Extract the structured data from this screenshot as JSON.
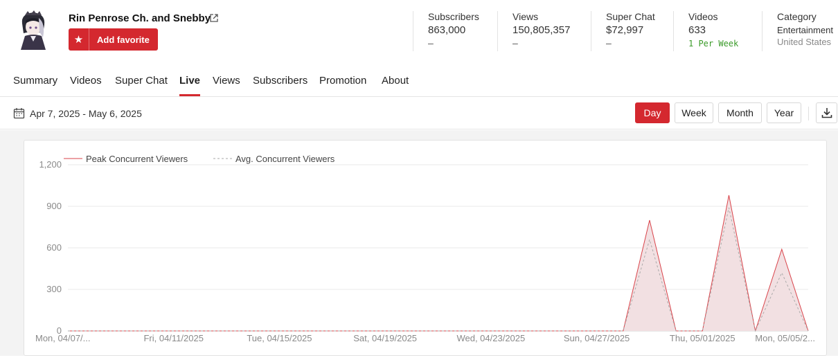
{
  "channel": {
    "name": "Rin Penrose Ch. and Snebby",
    "favorite_label": "Add favorite"
  },
  "stats": {
    "subscribers": {
      "title": "Subscribers",
      "value": "863,000",
      "delta": "–"
    },
    "views": {
      "title": "Views",
      "value": "150,805,357",
      "delta": "–"
    },
    "superchat": {
      "title": "Super Chat",
      "value": "$72,997",
      "delta": "–"
    },
    "videos": {
      "title": "Videos",
      "value": "633",
      "rate": "1 Per Week"
    },
    "category": {
      "title": "Category",
      "value": "Entertainment",
      "country": "United States"
    }
  },
  "tabs": [
    "Summary",
    "Videos",
    "Super Chat",
    "Live",
    "Views",
    "Subscribers",
    "Promotion",
    "About"
  ],
  "active_tab": "Live",
  "toolbar": {
    "date_range": "Apr 7, 2025 - May 6, 2025",
    "periods": [
      "Day",
      "Week",
      "Month",
      "Year"
    ],
    "active_period": "Day"
  },
  "colors": {
    "accent": "#d4282f",
    "peak_line": "#d9434a",
    "peak_fill": "#f2e0e2",
    "avg_line": "#aaaaaa",
    "positive": "#3a9a28"
  },
  "chart_data": {
    "type": "area",
    "x": [
      "04/07",
      "04/08",
      "04/09",
      "04/10",
      "04/11",
      "04/12",
      "04/13",
      "04/14",
      "04/15",
      "04/16",
      "04/17",
      "04/18",
      "04/19",
      "04/20",
      "04/21",
      "04/22",
      "04/23",
      "04/24",
      "04/25",
      "04/26",
      "04/27",
      "04/28",
      "04/29",
      "04/30",
      "05/01",
      "05/02",
      "05/03",
      "05/04",
      "05/05",
      "05/06"
    ],
    "series": [
      {
        "name": "Peak Concurrent Viewers",
        "style": "solid",
        "values": [
          0,
          0,
          0,
          0,
          0,
          0,
          0,
          0,
          0,
          0,
          0,
          0,
          0,
          0,
          0,
          0,
          0,
          0,
          0,
          0,
          0,
          0,
          800,
          0,
          0,
          980,
          0,
          590,
          0
        ]
      },
      {
        "name": "Avg. Concurrent Viewers",
        "style": "dashed",
        "values": [
          0,
          0,
          0,
          0,
          0,
          0,
          0,
          0,
          0,
          0,
          0,
          0,
          0,
          0,
          0,
          0,
          0,
          0,
          0,
          0,
          0,
          0,
          660,
          0,
          0,
          890,
          0,
          420,
          0
        ]
      }
    ],
    "x_tick_labels": [
      "Mon, 04/07/...",
      "Fri, 04/11/2025",
      "Tue, 04/15/2025",
      "Sat, 04/19/2025",
      "Wed, 04/23/2025",
      "Sun, 04/27/2025",
      "Thu, 05/01/2025",
      "Mon, 05/05/2..."
    ],
    "y_ticks": [
      "0",
      "300",
      "600",
      "900",
      "1,200"
    ],
    "ylim": [
      0,
      1200
    ],
    "grid": true,
    "legend": "top-left"
  }
}
